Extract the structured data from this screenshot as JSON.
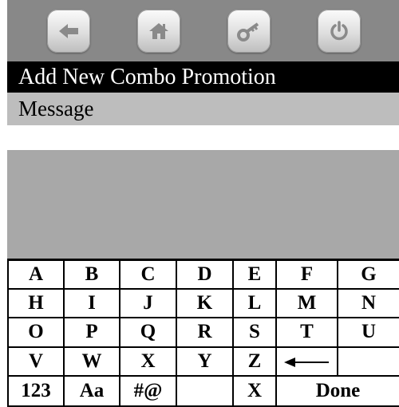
{
  "toolbar": {
    "buttons": [
      {
        "icon": "back-arrow-icon"
      },
      {
        "icon": "home-icon"
      },
      {
        "icon": "key-icon"
      },
      {
        "icon": "power-icon"
      }
    ]
  },
  "title": "Add New Combo Promotion",
  "field_label": "Message",
  "field_value": "",
  "keyboard": {
    "row1": [
      "A",
      "B",
      "C",
      "D",
      "E",
      "F",
      "G"
    ],
    "row2": [
      "H",
      "I",
      "J",
      "K",
      "L",
      "M",
      "N"
    ],
    "row3": [
      "O",
      "P",
      "Q",
      "R",
      "S",
      "T",
      "U"
    ],
    "row4": [
      "V",
      "W",
      "X",
      "Y",
      "Z"
    ],
    "row5": [
      "123",
      "Aa",
      "#@",
      "",
      "X",
      "Done"
    ],
    "backspace_icon": "backspace-arrow-icon"
  },
  "colors": {
    "toolbar_bg": "#888888",
    "title_bg": "#000000",
    "label_bg": "#bdbdbd",
    "panel_bg": "#a8a8a8",
    "icon_color": "#8a8a8a"
  }
}
